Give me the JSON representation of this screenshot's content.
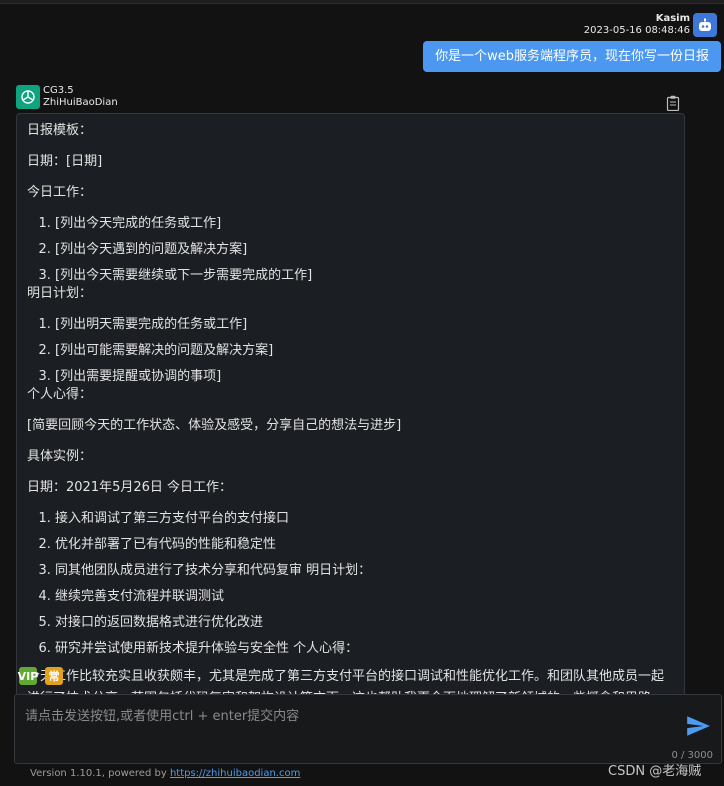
{
  "user": {
    "name": "Kasim",
    "timestamp": "2023-05-16 08:48:46",
    "message": "你是一个web服务端程序员，现在你写一份日报"
  },
  "assistant": {
    "model": "CG3.5",
    "app_name": "ZhiHuiBaoDian",
    "template_title": "日报模板：",
    "date_line": "日期：[日期]",
    "today_heading": "今日工作：",
    "today_items": [
      "[列出今天完成的任务或工作]",
      "[列出今天遇到的问题及解决方案]",
      "[列出今天需要继续或下一步需要完成的工作]"
    ],
    "tomorrow_heading": "明日计划：",
    "tomorrow_items": [
      "[列出明天需要完成的任务或工作]",
      "[列出可能需要解决的问题及解决方案]",
      "[列出需要提醒或协调的事项]"
    ],
    "reflection_heading": "个人心得：",
    "reflection_text": "[简要回顾今天的工作状态、体验及感受，分享自己的想法与进步]",
    "example_heading": "具体实例：",
    "example_date_line": "日期：2021年5月26日 今日工作：",
    "example_items": [
      "接入和调试了第三方支付平台的支付接口",
      "优化并部署了已有代码的性能和稳定性",
      "同其他团队成员进行了技术分享和代码复审 明日计划：",
      "继续完善支付流程并联调测试",
      "对接口的返回数据格式进行优化改进",
      "研究并尝试使用新技术提升体验与安全性 个人心得："
    ],
    "example_paragraph": "今天工作比较充实且收获颇丰，尤其是完成了第三方支付平台的接口调试和性能优化工作。和团队其他成员一起进行了技术分享、范围包括代码复审和架构设计等方面，这也帮助我更全面地理解了新领域的一些概念和思路。总"
  },
  "badges": {
    "vip": "VIP",
    "chang": "常"
  },
  "input": {
    "placeholder": "请点击发送按钮,或者使用ctrl + enter提交内容",
    "value": "",
    "counter": "0 / 3000"
  },
  "footer": {
    "version_text": "Version 1.10.1, powered by ",
    "link_text": "https://zhihuibaodian.com"
  },
  "watermark": "CSDN @老海贼",
  "colors": {
    "background": "#121212",
    "user_bubble": "#4c98f0",
    "send_icon": "#4d9cf0",
    "bot_avatar": "#10a37f",
    "vip_badge": "#63a832",
    "chang_badge": "#e3a21a"
  }
}
